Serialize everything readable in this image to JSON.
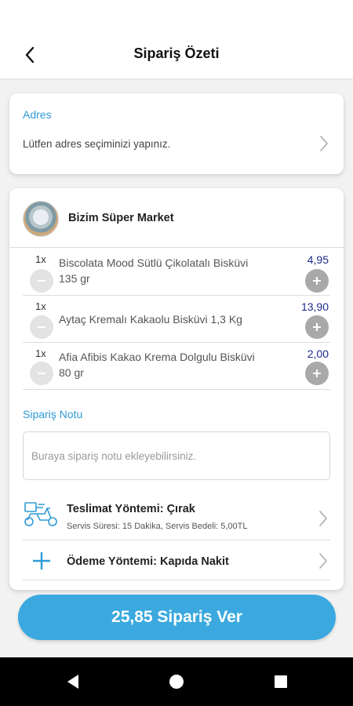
{
  "header": {
    "title": "Sipariş Özeti"
  },
  "address": {
    "title": "Adres",
    "text": "Lütfen adres seçiminizi yapınız."
  },
  "store": {
    "name": "Bizim Süper Market"
  },
  "items": [
    {
      "qty": "1x",
      "name": "Biscolata Mood Sütlü Çikolatalı Bisküvi 135 gr",
      "price": "4,95"
    },
    {
      "qty": "1x",
      "name": "Aytaç Kremalı Kakaolu Bisküvi 1,3 Kg",
      "price": "13,90"
    },
    {
      "qty": "1x",
      "name": "Afia Afibis Kakao Krema Dolgulu Bisküvi 80 gr",
      "price": "2,00"
    }
  ],
  "note": {
    "title": "Sipariş Notu",
    "placeholder": "Buraya sipariş notu ekleyebilirsiniz."
  },
  "delivery": {
    "title": "Teslimat Yöntemi: Çırak",
    "subtitle": "Servis Süresi: 15  Dakika, Servis Bedeli: 5,00TL",
    "icon": "scooter-icon"
  },
  "payment": {
    "title": "Ödeme Yöntemi: Kapıda Nakit",
    "icon": "plus-icon"
  },
  "order_button": {
    "label": "25,85 Sipariş Ver"
  },
  "colors": {
    "accent": "#3ba9df",
    "section_title": "#2e9bd6",
    "price": "#1c2a8f"
  }
}
